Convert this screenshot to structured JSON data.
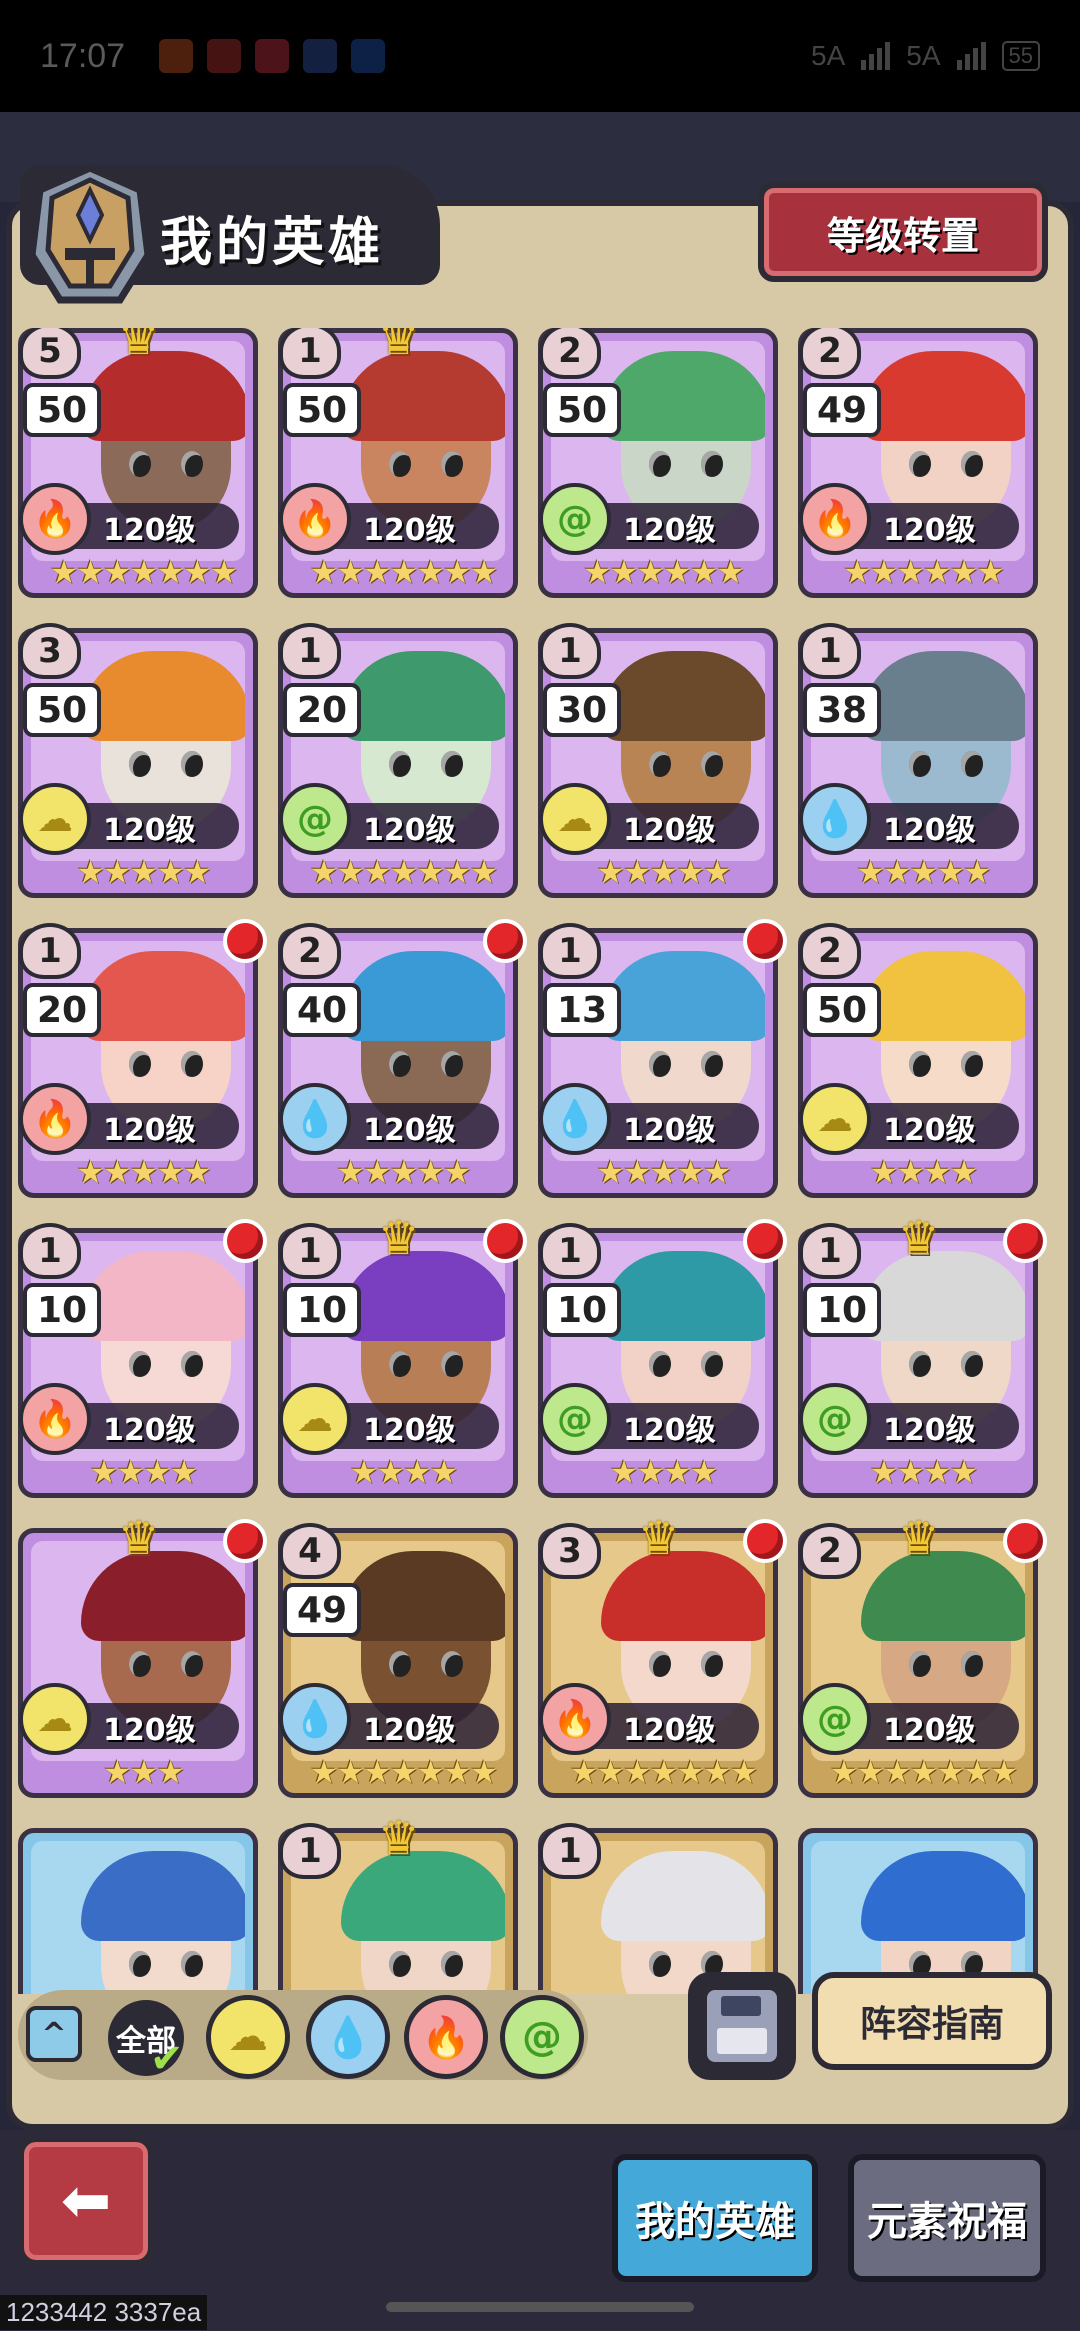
{
  "status_bar": {
    "time": "17:07",
    "network_1": "5A",
    "network_2": "5A",
    "battery": "55"
  },
  "header": {
    "title": "我的英雄",
    "level_transfer_label": "等级转置"
  },
  "heroes": [
    {
      "rank": "5",
      "num": "50",
      "level": "120级",
      "element": "fire",
      "stars": 7,
      "frame": "purple",
      "crown": true,
      "dot": false,
      "face": "#8b6a5a",
      "hair": "#b52c2c"
    },
    {
      "rank": "1",
      "num": "50",
      "level": "120级",
      "element": "fire",
      "stars": 7,
      "frame": "purple",
      "crown": true,
      "dot": false,
      "face": "#c98560",
      "hair": "#b53a2f"
    },
    {
      "rank": "2",
      "num": "50",
      "level": "120级",
      "element": "wind",
      "stars": 6,
      "frame": "purple",
      "crown": false,
      "dot": false,
      "face": "#c9d6c8",
      "hair": "#4ea86a"
    },
    {
      "rank": "2",
      "num": "49",
      "level": "120级",
      "element": "fire",
      "stars": 6,
      "frame": "purple",
      "crown": false,
      "dot": false,
      "face": "#f2d2c4",
      "hair": "#d93a2f"
    },
    {
      "rank": "3",
      "num": "50",
      "level": "120级",
      "element": "earth",
      "stars": 5,
      "frame": "purple",
      "crown": false,
      "dot": false,
      "face": "#e8e2da",
      "hair": "#e88a2e"
    },
    {
      "rank": "1",
      "num": "20",
      "level": "120级",
      "element": "wind",
      "stars": 7,
      "frame": "purple",
      "crown": false,
      "dot": false,
      "face": "#d6e8d0",
      "hair": "#3e9a6c"
    },
    {
      "rank": "1",
      "num": "30",
      "level": "120级",
      "element": "earth",
      "stars": 5,
      "frame": "purple",
      "crown": false,
      "dot": false,
      "face": "#b88454",
      "hair": "#6a4a2a"
    },
    {
      "rank": "1",
      "num": "38",
      "level": "120级",
      "element": "water",
      "stars": 5,
      "frame": "purple",
      "crown": false,
      "dot": false,
      "face": "#9bbad0",
      "hair": "#6a7f8e"
    },
    {
      "rank": "1",
      "num": "20",
      "level": "120级",
      "element": "fire",
      "stars": 5,
      "frame": "purple",
      "crown": false,
      "dot": true,
      "face": "#f6d3c6",
      "hair": "#e3574e"
    },
    {
      "rank": "2",
      "num": "40",
      "level": "120级",
      "element": "water",
      "stars": 5,
      "frame": "purple",
      "crown": false,
      "dot": true,
      "face": "#8a6a54",
      "hair": "#3a9ad6"
    },
    {
      "rank": "1",
      "num": "13",
      "level": "120级",
      "element": "water",
      "stars": 5,
      "frame": "purple",
      "crown": false,
      "dot": true,
      "face": "#f0d8cc",
      "hair": "#4aa3d8"
    },
    {
      "rank": "2",
      "num": "50",
      "level": "120级",
      "element": "earth",
      "stars": 4,
      "frame": "purple",
      "crown": false,
      "dot": false,
      "face": "#f6dcc8",
      "hair": "#f0c240"
    },
    {
      "rank": "1",
      "num": "10",
      "level": "120级",
      "element": "fire",
      "stars": 4,
      "frame": "purple",
      "crown": false,
      "dot": true,
      "face": "#f6d8d4",
      "hair": "#f2b6c6"
    },
    {
      "rank": "1",
      "num": "10",
      "level": "120级",
      "element": "earth",
      "stars": 4,
      "frame": "purple",
      "crown": true,
      "dot": true,
      "face": "#b87e56",
      "hair": "#7a3ec0"
    },
    {
      "rank": "1",
      "num": "10",
      "level": "120级",
      "element": "wind",
      "stars": 4,
      "frame": "purple",
      "crown": false,
      "dot": true,
      "face": "#f2d2c6",
      "hair": "#2e9aa6"
    },
    {
      "rank": "1",
      "num": "10",
      "level": "120级",
      "element": "wind",
      "stars": 4,
      "frame": "purple",
      "crown": true,
      "dot": true,
      "face": "#efd8c8",
      "hair": "#d8d8d8"
    },
    {
      "rank": "",
      "num": "",
      "level": "120级",
      "element": "earth",
      "stars": 3,
      "frame": "purple",
      "crown": true,
      "dot": true,
      "face": "#a86a4e",
      "hair": "#8a1e2a"
    },
    {
      "rank": "4",
      "num": "49",
      "level": "120级",
      "element": "water",
      "stars": 7,
      "frame": "gold",
      "crown": false,
      "dot": false,
      "face": "#7a5232",
      "hair": "#5a3a22"
    },
    {
      "rank": "3",
      "num": "",
      "level": "120级",
      "element": "fire",
      "stars": 7,
      "frame": "gold",
      "crown": true,
      "dot": true,
      "face": "#f4d8cc",
      "hair": "#c92f2a"
    },
    {
      "rank": "2",
      "num": "",
      "level": "120级",
      "element": "wind",
      "stars": 7,
      "frame": "gold",
      "crown": true,
      "dot": true,
      "face": "#d6a884",
      "hair": "#3f8a4e"
    },
    {
      "rank": "",
      "num": "",
      "level": "",
      "element": "",
      "stars": 0,
      "frame": "blue",
      "crown": false,
      "dot": false,
      "face": "#f2dacc",
      "hair": "#3a6ec6"
    },
    {
      "rank": "1",
      "num": "",
      "level": "",
      "element": "",
      "stars": 0,
      "frame": "gold",
      "crown": true,
      "dot": false,
      "face": "#f0d6c6",
      "hair": "#3aa87a"
    },
    {
      "rank": "1",
      "num": "",
      "level": "",
      "element": "",
      "stars": 0,
      "frame": "gold",
      "crown": false,
      "dot": false,
      "face": "#f2d8c8",
      "hair": "#e4e4e8"
    },
    {
      "rank": "",
      "num": "",
      "level": "",
      "element": "",
      "stars": 0,
      "frame": "blue",
      "crown": false,
      "dot": false,
      "face": "#f2d4c4",
      "hair": "#2f6ed0"
    }
  ],
  "filter": {
    "all_label": "全部",
    "elements": [
      "earth",
      "water",
      "fire",
      "wind"
    ]
  },
  "actions": {
    "lineup_guide_label": "阵容指南"
  },
  "nav": {
    "tab_my_heroes": "我的英雄",
    "tab_element_blessing": "元素祝福"
  },
  "footnote": "1233442 3337ea",
  "colors": {
    "panel": "#d7c8a6",
    "purple_frame": "#c08ee0",
    "gold_frame": "#c9a45d",
    "accent_red": "#a7323e",
    "active_tab": "#44a8d8"
  }
}
